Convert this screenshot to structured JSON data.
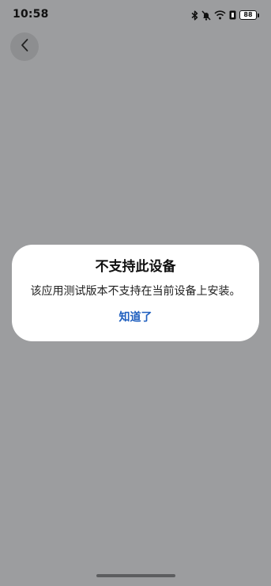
{
  "status_bar": {
    "time": "10:58",
    "battery_level": "88",
    "icons": [
      "bluetooth-icon",
      "mute-bell-icon",
      "wifi-icon",
      "signal-badge-icon",
      "battery-icon"
    ]
  },
  "nav": {
    "back_icon": "chevron-left-icon"
  },
  "dialog": {
    "title": "不支持此设备",
    "message": "该应用测试版本不支持在当前设备上安装。",
    "button_label": "知道了"
  },
  "colors": {
    "background_overlay": "#9c9d9f",
    "dialog_background": "#ffffff",
    "button_text": "#1f5fbf"
  }
}
